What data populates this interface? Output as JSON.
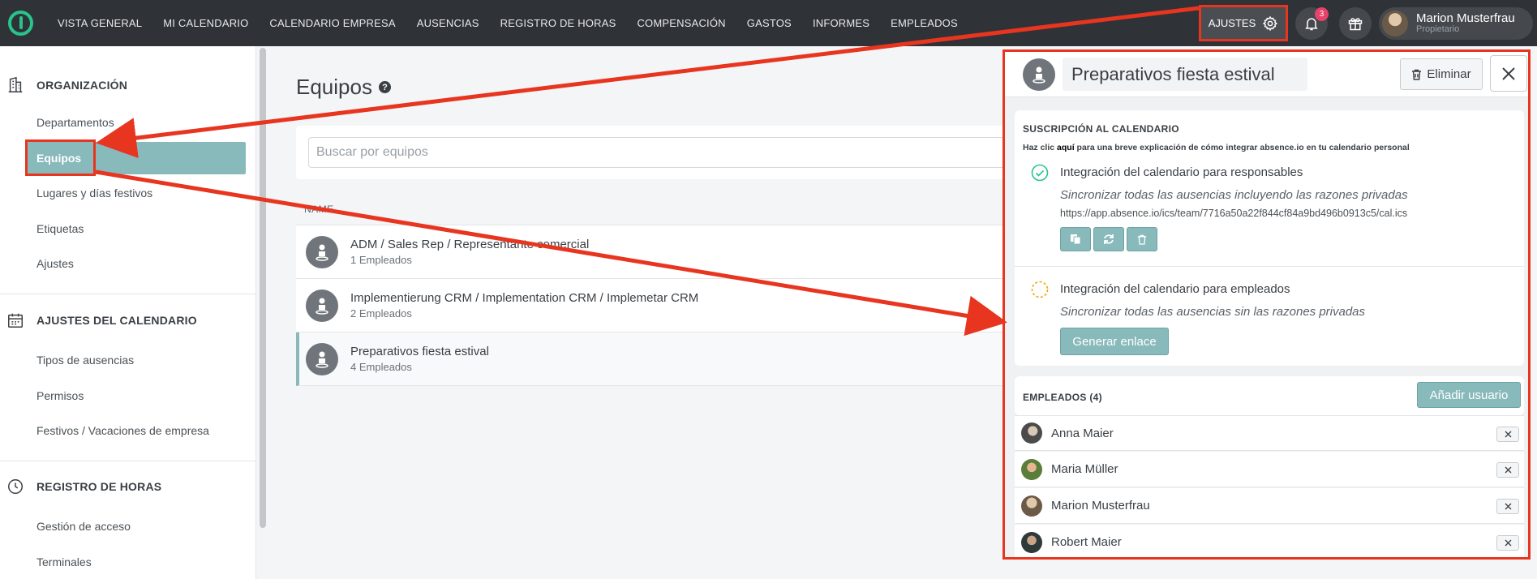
{
  "nav": {
    "items": [
      "VISTA GENERAL",
      "MI CALENDARIO",
      "CALENDARIO EMPRESA",
      "AUSENCIAS",
      "REGISTRO DE HORAS",
      "COMPENSACIÓN",
      "GASTOS",
      "INFORMES",
      "EMPLEADOS"
    ],
    "settings_label": "AJUSTES",
    "notification_count": "3",
    "user_name": "Marion Musterfrau",
    "user_role": "Propietario"
  },
  "sidebar": {
    "sections": [
      {
        "title": "ORGANIZACIÓN",
        "icon": "building-icon",
        "items": [
          "Departamentos",
          "Equipos",
          "Lugares y días festivos",
          "Etiquetas",
          "Ajustes"
        ]
      },
      {
        "title": "AJUSTES DEL CALENDARIO",
        "icon": "calendar-icon",
        "items": [
          "Tipos de ausencias",
          "Permisos",
          "Festivos / Vacaciones de empresa"
        ]
      },
      {
        "title": "REGISTRO DE HORAS",
        "icon": "clock-icon",
        "items": [
          "Gestión de acceso",
          "Terminales"
        ]
      }
    ],
    "active_item": "Equipos"
  },
  "main": {
    "title": "Equipos",
    "search_placeholder": "Buscar por equipos",
    "column_name": "NAME",
    "teams": [
      {
        "name": "ADM / Sales Rep / Representante comercial",
        "count": "1 Empleados"
      },
      {
        "name": "Implementierung CRM / Implementation CRM / Implemetar CRM",
        "count": "2 Empleados"
      },
      {
        "name": "Preparativos fiesta estival",
        "count": "4 Empleados"
      }
    ]
  },
  "panel": {
    "team_name": "Preparativos fiesta estival",
    "delete_label": "Eliminar",
    "subscription_title": "SUSCRIPCIÓN AL CALENDARIO",
    "hint_prefix": "Haz clic",
    "hint_link": "aquí",
    "hint_suffix": "para una breve explicación de cómo integrar absence.io en tu calendario personal",
    "managers": {
      "title": "Integración del calendario para responsables",
      "subtitle": "Sincronizar todas las ausencias incluyendo las razones privadas",
      "url": "https://app.absence.io/ics/team/7716a50a22f844cf84a9bd496b0913c5/cal.ics"
    },
    "employees_integration": {
      "title": "Integración del calendario para empleados",
      "subtitle": "Sincronizar todas las ausencias sin las razones privadas",
      "button": "Generar enlace"
    },
    "employees_title": "EMPLEADOS (4)",
    "add_user_label": "Añadir usuario",
    "employees": [
      "Anna Maier",
      "Maria Müller",
      "Marion Musterfrau",
      "Robert Maier"
    ]
  },
  "colors": {
    "accent": "#88b9bb",
    "topbar": "#2f3236",
    "annotation": "#e8351f",
    "success": "#27c48b",
    "pending": "#f0a500"
  }
}
